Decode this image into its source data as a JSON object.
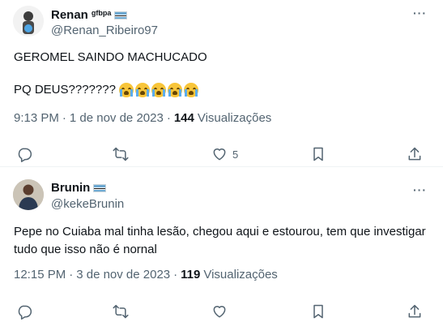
{
  "tweets": [
    {
      "name": "Renan",
      "name_tag": "gfbpa",
      "handle": "@Renan_Ribeiro97",
      "text_line1": "GEROMEL SAINDO MACHUCADO",
      "text_line2": "PQ DEUS???????",
      "emoji": [
        "loudly-crying-face",
        "loudly-crying-face",
        "loudly-crying-face",
        "loudly-crying-face",
        "loudly-crying-face"
      ],
      "time": "9:13 PM",
      "date": "1 de nov de 2023",
      "views_count": "144",
      "views_label": "Visualizações",
      "likes": "5",
      "more_label": "···"
    },
    {
      "name": "Brunin",
      "handle": "@kekeBrunin",
      "text": "Pepe no Cuiaba mal tinha lesão, chegou aqui e estourou, tem que investigar tudo que isso não é nornal",
      "time": "12:15 PM",
      "date": "3 de nov de 2023",
      "views_count": "119",
      "views_label": "Visualizações",
      "more_label": "···"
    }
  ],
  "separator": "·",
  "colors": {
    "text": "#0f1419",
    "secondary": "#536471",
    "divider": "#eff3f4"
  }
}
